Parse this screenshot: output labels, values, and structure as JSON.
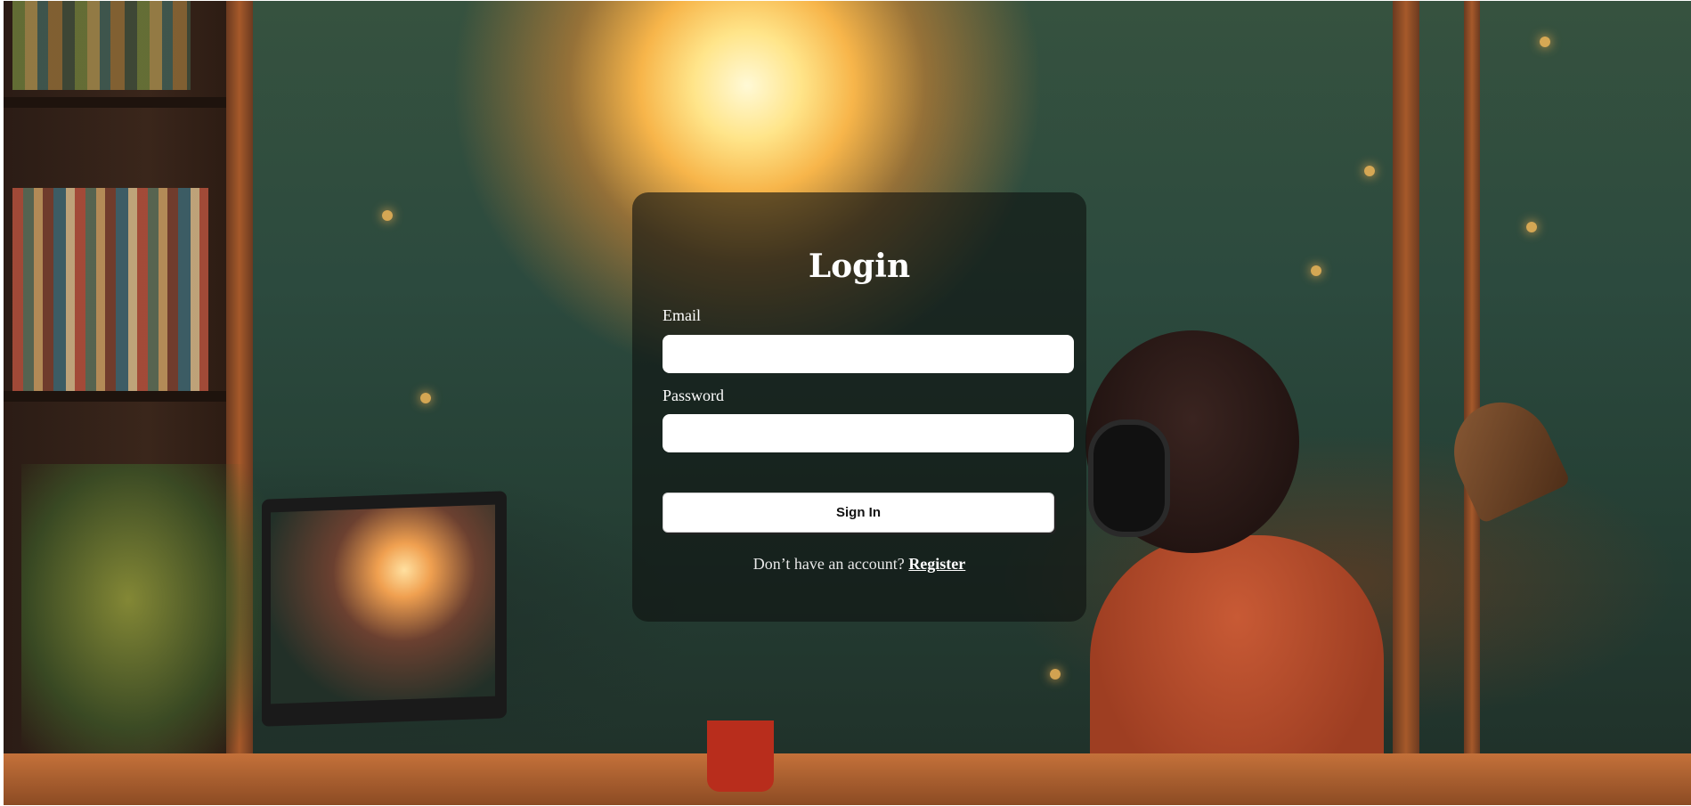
{
  "page": {
    "background_image": "cozy-lofi-desk-forest-window"
  },
  "login": {
    "title": "Login",
    "email_label": "Email",
    "email_value": "",
    "password_label": "Password",
    "password_value": "",
    "signin_label": "Sign In",
    "register_prompt": "Don’t have an account?",
    "register_link": "Register"
  },
  "colors": {
    "card_background": "#0f1210",
    "text": "#ffffff",
    "button_background": "#ffffff"
  }
}
